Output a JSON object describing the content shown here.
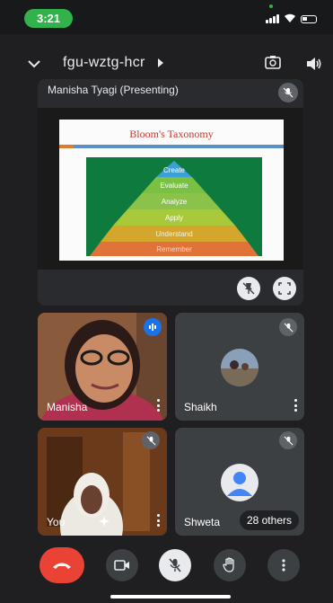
{
  "status_bar": {
    "time": "3:21"
  },
  "header": {
    "meeting_code": "fgu-wztg-hcr",
    "icons": [
      "chevron-down-icon",
      "caret-right-icon",
      "camera-flip-icon",
      "speaker-icon"
    ]
  },
  "presentation": {
    "presenter_label": "Manisha Tyagi (Presenting)",
    "slide": {
      "title": "Bloom's Taxonomy",
      "levels": [
        "Create",
        "Evaluate",
        "Analyze",
        "Apply",
        "Understand",
        "Remember"
      ]
    },
    "controls": [
      "pin-off-icon",
      "fullscreen-icon"
    ]
  },
  "participants": [
    {
      "name": "Manisha",
      "muted": false,
      "speaking": true
    },
    {
      "name": "Shaikh",
      "muted": true
    },
    {
      "name": "You",
      "muted": true
    },
    {
      "name": "Shweta",
      "muted": true,
      "others_label": "28 others"
    }
  ],
  "bottom_bar": {
    "buttons": [
      "end-call-icon",
      "camera-icon",
      "mic-off-icon",
      "raise-hand-icon",
      "more-options-icon"
    ]
  },
  "colors": {
    "end_call": "#ea4335",
    "speaking_badge": "#1a73e8",
    "status_pill": "#32b24a",
    "slide_title": "#c0392b"
  }
}
